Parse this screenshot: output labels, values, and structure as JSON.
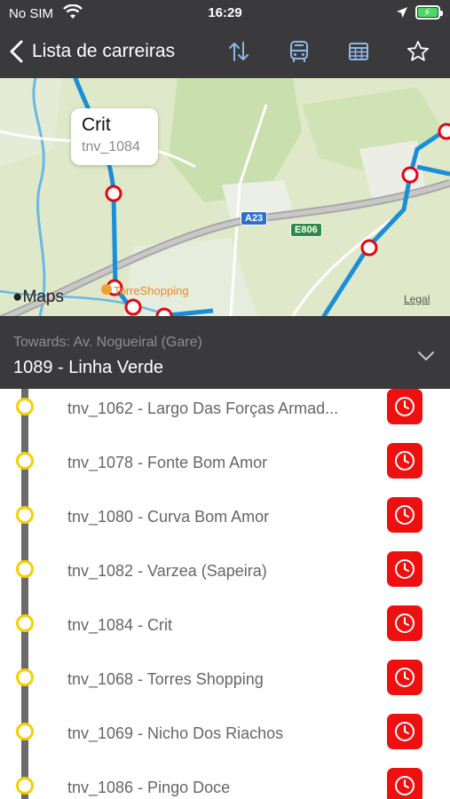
{
  "status_bar": {
    "carrier": "No SIM",
    "time": "16:29"
  },
  "nav": {
    "back_label": "Lista de carreiras",
    "icons": [
      "sort-icon",
      "bus-icon",
      "calendar-icon",
      "star-icon"
    ]
  },
  "map": {
    "callout_title": "Crit",
    "callout_subtitle": "tnv_1084",
    "maps_brand": "Maps",
    "legal": "Legal",
    "poi_label": "TorreShopping",
    "road_a23": "A23",
    "road_e806": "E806"
  },
  "route": {
    "towards": "Towards: Av. Nogueiral (Gare)",
    "line": "1089 - Linha Verde"
  },
  "stops": [
    {
      "label": "tnv_1062 - Largo Das Forças Armad..."
    },
    {
      "label": "tnv_1078 - Fonte Bom Amor"
    },
    {
      "label": "tnv_1080 - Curva Bom Amor"
    },
    {
      "label": "tnv_1082 - Varzea (Sapeira)"
    },
    {
      "label": "tnv_1084 - Crit"
    },
    {
      "label": "tnv_1068 - Torres Shopping"
    },
    {
      "label": "tnv_1069 - Nicho Dos Riachos"
    },
    {
      "label": "tnv_1086 - Pingo Doce"
    }
  ],
  "colors": {
    "bar_bg": "#3a3a3c",
    "stop_dot": "#f5d000",
    "schedule_button": "#ee0f0f",
    "route_line": "#1a8fd6"
  }
}
